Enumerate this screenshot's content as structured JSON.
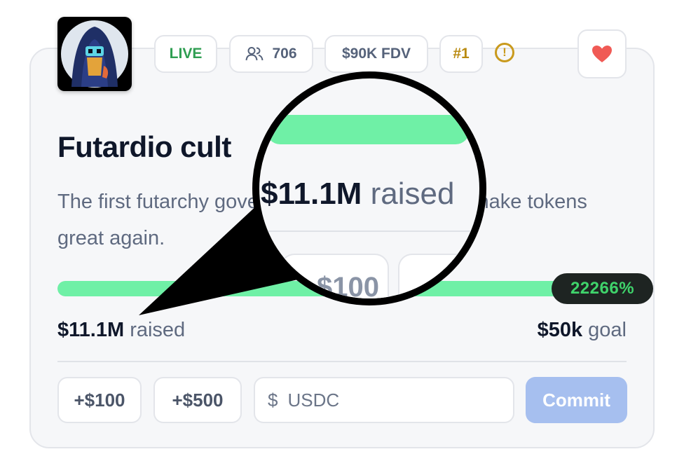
{
  "header": {
    "status_badge": "LIVE",
    "participants": "706",
    "fdv": "$90K FDV",
    "rank": "#1",
    "warning_glyph": "!"
  },
  "project": {
    "title": "Futardio cult",
    "description": "The first futarchy governed meme that we will make tokens great again."
  },
  "progress": {
    "fill_fraction": 1.0,
    "percent_label": "22266%",
    "raised_amount": "$11.1M",
    "raised_label": "raised",
    "goal_amount": "$50k",
    "goal_label": "goal"
  },
  "actions": {
    "add_100": "+$100",
    "add_500": "+$500",
    "currency_symbol": "$",
    "amount_placeholder": "USDC",
    "commit": "Commit"
  },
  "magnifier": {
    "amount": "$11.1M",
    "label": "raised",
    "button_fragment": "$100"
  },
  "colors": {
    "accent_green": "#6ff0a6",
    "live_green": "#2f9e52",
    "rank_gold": "#b98a10",
    "heart_red": "#f05a55",
    "commit_blue": "#a6bfef"
  },
  "icons": [
    "avatar-hooded-figure",
    "users-icon",
    "warning-icon",
    "heart-icon"
  ]
}
